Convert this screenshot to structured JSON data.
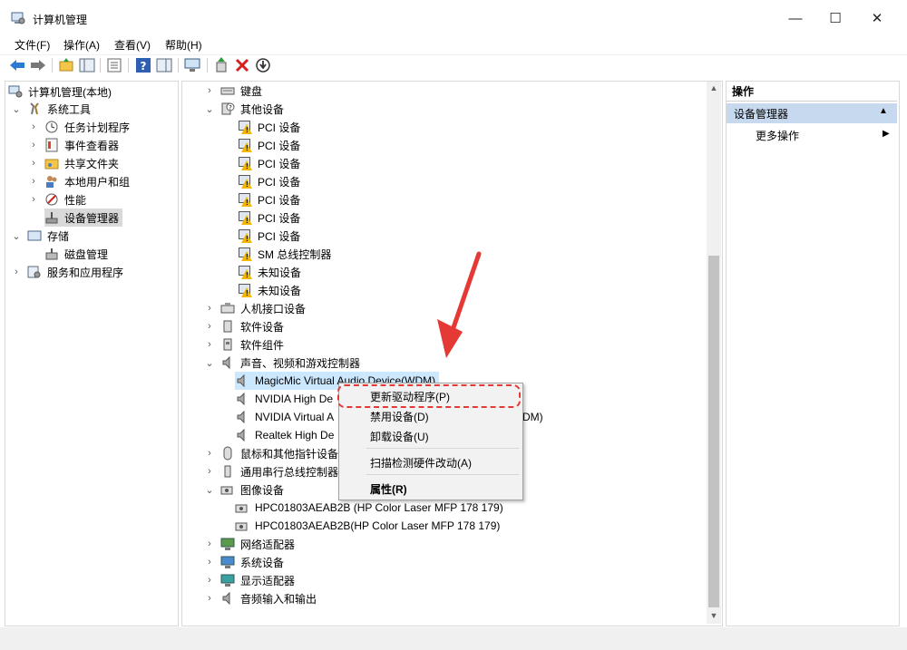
{
  "window": {
    "title": "计算机管理",
    "minimize": "—",
    "maximize": "☐",
    "close": "✕"
  },
  "menu": [
    "文件(F)",
    "操作(A)",
    "查看(V)",
    "帮助(H)"
  ],
  "colors": {
    "selection": "#cce8ff",
    "section_header": "#c7d9ee",
    "annotation": "#e53935",
    "warning": "#f2b800"
  },
  "left_tree": [
    {
      "label": "计算机管理(本地)",
      "icon": "computer-management-icon"
    },
    {
      "label": "系统工具",
      "icon": "tools-icon"
    },
    {
      "label": "任务计划程序",
      "icon": "clock-icon"
    },
    {
      "label": "事件查看器",
      "icon": "event-viewer-icon"
    },
    {
      "label": "共享文件夹",
      "icon": "shared-folder-icon"
    },
    {
      "label": "本地用户和组",
      "icon": "users-icon"
    },
    {
      "label": "性能",
      "icon": "performance-icon"
    },
    {
      "label": "设备管理器",
      "icon": "device-manager-icon"
    },
    {
      "label": "存储",
      "icon": "storage-icon"
    },
    {
      "label": "磁盘管理",
      "icon": "disk-icon"
    },
    {
      "label": "服务和应用程序",
      "icon": "services-icon"
    }
  ],
  "device_tree": [
    {
      "label": "键盘",
      "icon": "keyboard-icon"
    },
    {
      "label": "其他设备",
      "icon": "other-devices-icon"
    },
    {
      "label": "PCI 设备",
      "icon": "warning-device-icon"
    },
    {
      "label": "PCI 设备",
      "icon": "warning-device-icon"
    },
    {
      "label": "PCI 设备",
      "icon": "warning-device-icon"
    },
    {
      "label": "PCI 设备",
      "icon": "warning-device-icon"
    },
    {
      "label": "PCI 设备",
      "icon": "warning-device-icon"
    },
    {
      "label": "PCI 设备",
      "icon": "warning-device-icon"
    },
    {
      "label": "PCI 设备",
      "icon": "warning-device-icon"
    },
    {
      "label": "SM 总线控制器",
      "icon": "warning-device-icon"
    },
    {
      "label": "未知设备",
      "icon": "warning-device-icon"
    },
    {
      "label": "未知设备",
      "icon": "warning-device-icon"
    },
    {
      "label": "人机接口设备",
      "icon": "hid-icon"
    },
    {
      "label": "软件设备",
      "icon": "software-device-icon"
    },
    {
      "label": "软件组件",
      "icon": "software-component-icon"
    },
    {
      "label": "声音、视频和游戏控制器",
      "icon": "speaker-icon"
    },
    {
      "label": "MagicMic Virtual Audio Device(WDM)",
      "icon": "speaker-icon"
    },
    {
      "label": "NVIDIA High De",
      "icon": "speaker-icon"
    },
    {
      "label": "NVIDIA Virtual A",
      "icon": "speaker-icon"
    },
    {
      "label": "Realtek High De",
      "icon": "speaker-icon"
    },
    {
      "label": "鼠标和其他指针设备",
      "icon": "mouse-icon"
    },
    {
      "label": "通用串行总线控制器",
      "icon": "usb-icon"
    },
    {
      "label": "图像设备",
      "icon": "camera-icon"
    },
    {
      "label": "HPC01803AEAB2B (HP Color Laser MFP 178 179)",
      "icon": "camera-icon"
    },
    {
      "label": "HPC01803AEAB2B(HP Color Laser MFP 178 179)",
      "icon": "camera-icon"
    },
    {
      "label": "网络适配器",
      "icon": "network-icon"
    },
    {
      "label": "系统设备",
      "icon": "system-device-icon"
    },
    {
      "label": "显示适配器",
      "icon": "display-icon"
    },
    {
      "label": "音频输入和输出",
      "icon": "audio-io-icon"
    }
  ],
  "obscured_tail": "(DM)",
  "context_menu": {
    "update_driver": "更新驱动程序(P)",
    "disable_device": "禁用设备(D)",
    "uninstall_device": "卸载设备(U)",
    "scan_hardware": "扫描检测硬件改动(A)",
    "properties": "属性(R)"
  },
  "actions": {
    "header": "操作",
    "section": "设备管理器",
    "more": "更多操作"
  }
}
